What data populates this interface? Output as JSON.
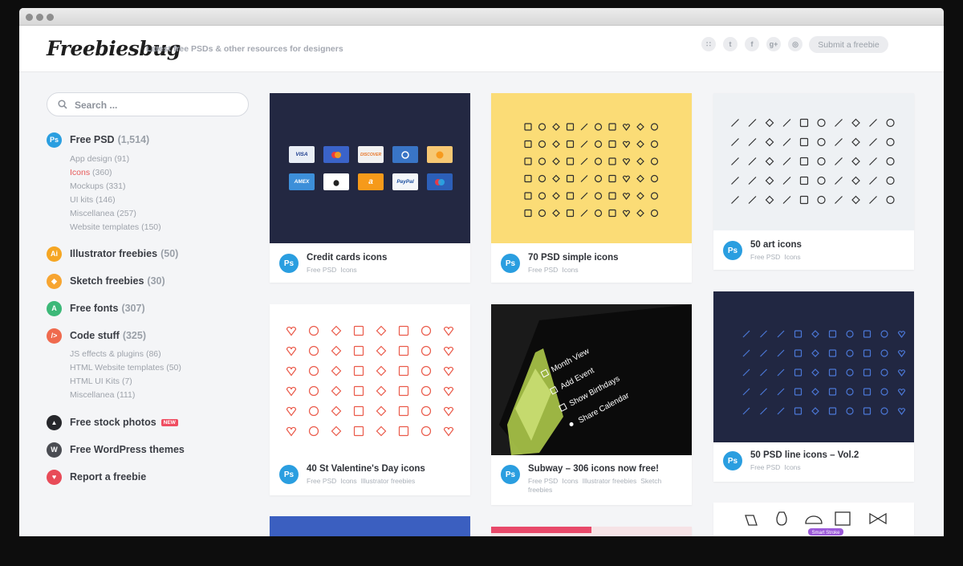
{
  "header": {
    "logo": "Freebiesbug",
    "tagline": "Latest free PSDs & other resources for designers",
    "submit_label": "Submit a freebie",
    "social": [
      {
        "icon": "rss-icon",
        "glyph": "∷"
      },
      {
        "icon": "twitter-icon",
        "glyph": "t"
      },
      {
        "icon": "facebook-icon",
        "glyph": "f"
      },
      {
        "icon": "google-plus-icon",
        "glyph": "g+"
      },
      {
        "icon": "dribbble-icon",
        "glyph": "◎"
      }
    ]
  },
  "search": {
    "placeholder": "Search ..."
  },
  "sidebar": {
    "categories": [
      {
        "icon_text": "Ps",
        "label": "Free PSD",
        "count": "(1,514)",
        "color": "#2a9ee0",
        "subs": [
          {
            "label": "App design",
            "count": "(91)"
          },
          {
            "label": "Icons",
            "count": "(360)",
            "active": true
          },
          {
            "label": "Mockups",
            "count": "(331)"
          },
          {
            "label": "UI kits",
            "count": "(146)"
          },
          {
            "label": "Miscellanea",
            "count": "(257)"
          },
          {
            "label": "Website templates",
            "count": "(150)"
          }
        ]
      },
      {
        "icon_text": "Ai",
        "label": "Illustrator freebies",
        "count": "(50)",
        "color": "#f5a623"
      },
      {
        "icon_text": "◆",
        "label": "Sketch freebies",
        "count": "(30)",
        "color": "#f7a531"
      },
      {
        "icon_text": "A",
        "label": "Free fonts",
        "count": "(307)",
        "color": "#3cb878"
      },
      {
        "icon_text": "/>",
        "label": "Code stuff",
        "count": "(325)",
        "color": "#ef6a4e",
        "subs": [
          {
            "label": "JS effects & plugins",
            "count": "(86)"
          },
          {
            "label": "HTML Website templates",
            "count": "(50)"
          },
          {
            "label": "HTML UI Kits",
            "count": "(7)"
          },
          {
            "label": "Miscellanea",
            "count": "(111)"
          }
        ]
      },
      {
        "icon_text": "▲",
        "label": "Free stock photos",
        "count": "",
        "color": "#26272b",
        "badge": "NEW"
      },
      {
        "icon_text": "W",
        "label": "Free WordPress themes",
        "count": "",
        "color": "#4a4c52"
      },
      {
        "icon_text": "♥",
        "label": "Report a freebie",
        "count": "",
        "color": "#e84b58"
      }
    ]
  },
  "cards": [
    {
      "title": "Credit cards icons",
      "tags": [
        "Free PSD",
        "Icons"
      ],
      "thumb_bg": "#232842"
    },
    {
      "title": "70 PSD simple icons",
      "tags": [
        "Free PSD",
        "Icons"
      ],
      "thumb_bg": "#fbdc76"
    },
    {
      "title": "50 art icons",
      "tags": [
        "Free PSD",
        "Icons"
      ],
      "thumb_bg": "#eef1f4"
    },
    {
      "title": "40 St Valentine's Day icons",
      "tags": [
        "Free PSD",
        "Icons",
        "Illustrator freebies"
      ],
      "thumb_bg": "#ffffff"
    },
    {
      "title": "Subway – 306 icons now free!",
      "tags": [
        "Free PSD",
        "Icons",
        "Illustrator freebies",
        "Sketch freebies"
      ],
      "thumb_bg": "#161616"
    },
    {
      "title": "50 PSD line icons – Vol.2",
      "tags": [
        "Free PSD",
        "Icons"
      ],
      "thumb_bg": "#212742"
    }
  ],
  "credit_cards": [
    "VISA",
    "",
    "DISCOVER",
    "",
    "",
    "AMEX",
    "",
    "a",
    "PayPal",
    ""
  ],
  "subway_menu": [
    "Month View",
    "Add Event",
    "Show Birthdays",
    "Share Calendar"
  ],
  "partial_badge": "Smart Stroke"
}
